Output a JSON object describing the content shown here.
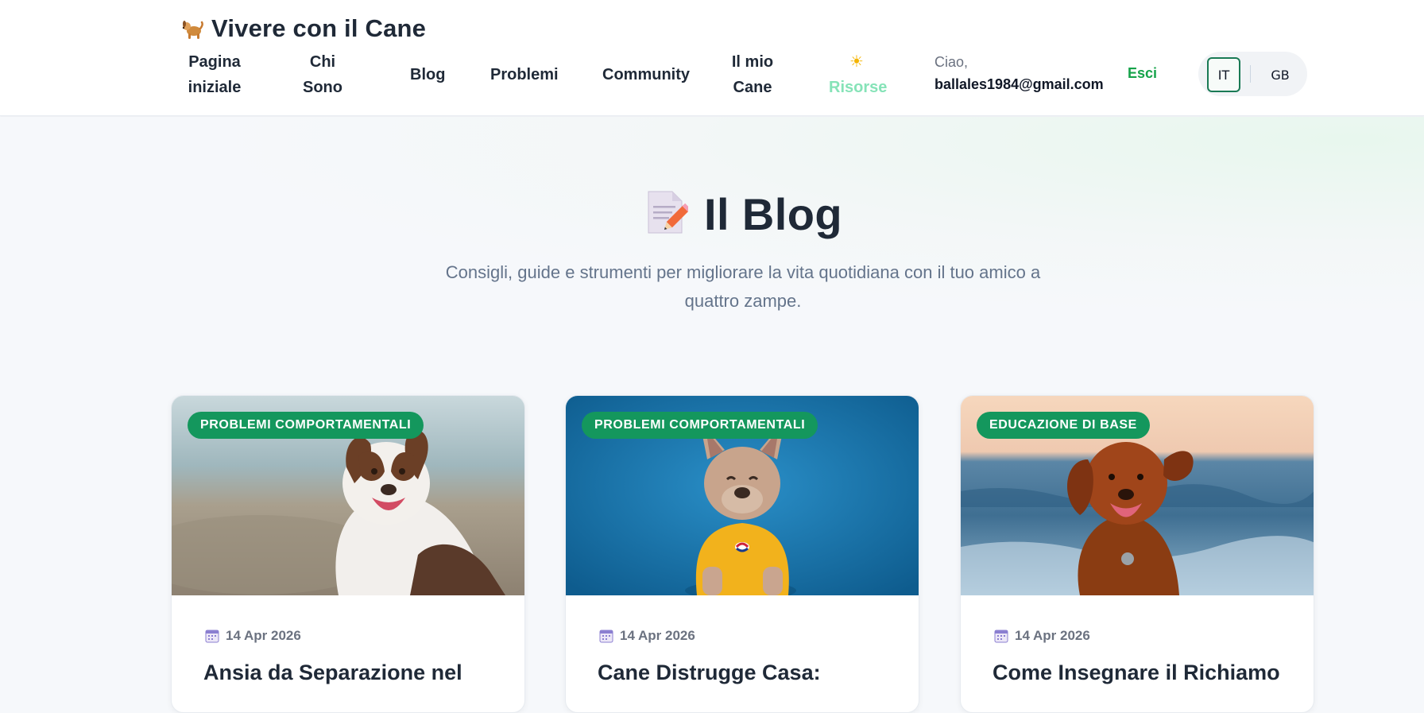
{
  "header": {
    "brand": {
      "emoji": "🐕",
      "title": "Vivere con il Cane"
    },
    "nav": [
      {
        "label": "Pagina iniziale"
      },
      {
        "label": "Chi Sono"
      },
      {
        "label": "Blog"
      },
      {
        "label": "Problemi"
      },
      {
        "label": "Community"
      },
      {
        "label": "Il mio Cane"
      },
      {
        "label": "Risorse"
      }
    ],
    "user": {
      "greeting": "Ciao,",
      "email": "ballales1984@gmail.com",
      "logout_label": "Esci"
    },
    "languages": [
      {
        "label": "IT",
        "selected": true
      },
      {
        "label": "GB",
        "selected": false
      }
    ],
    "colors": {
      "accent": "#16a34a",
      "risorse_text": "#86e3b8"
    }
  },
  "hero": {
    "emoji": "📝",
    "title": "Il Blog",
    "subtitle": "Consigli, guide e strumenti per migliorare la vita quotidiana con il tuo amico a quattro zampe."
  },
  "cards": [
    {
      "category": "PROBLEMI COMPORTAMENTALI",
      "date": "14 Apr 2026",
      "title": "Ansia da Separazione nel"
    },
    {
      "category": "PROBLEMI COMPORTAMENTALI",
      "date": "14 Apr 2026",
      "title": "Cane Distrugge Casa:"
    },
    {
      "category": "EDUCAZIONE DI BASE",
      "date": "14 Apr 2026",
      "title": "Come Insegnare il Richiamo"
    }
  ]
}
